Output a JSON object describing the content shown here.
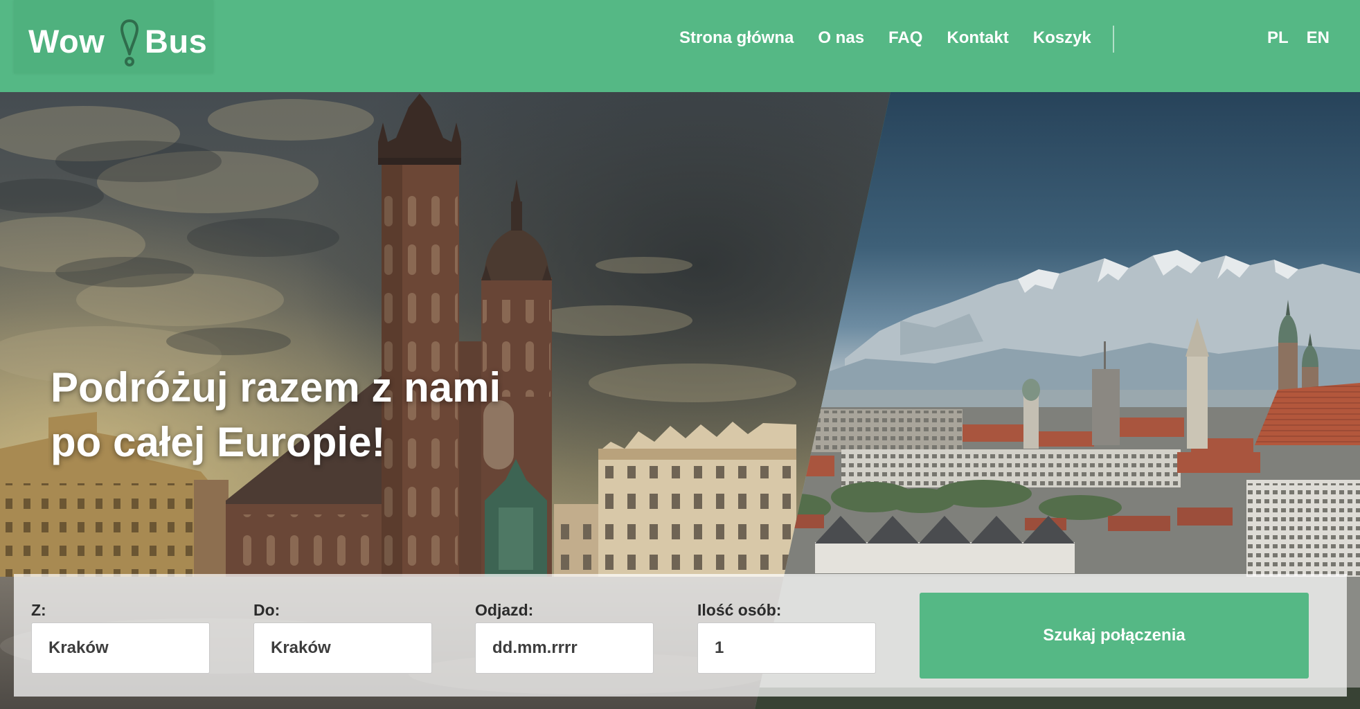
{
  "header": {
    "logo": {
      "part1": "Wow",
      "part2": "Bus",
      "icon": "exclamation-pin-icon"
    },
    "nav": [
      {
        "label": "Strona główna"
      },
      {
        "label": "O nas"
      },
      {
        "label": "FAQ"
      },
      {
        "label": "Kontakt"
      },
      {
        "label": "Koszyk"
      }
    ],
    "languages": [
      {
        "label": "PL"
      },
      {
        "label": "EN"
      }
    ]
  },
  "hero": {
    "title_line1": "Podróżuj razem z nami",
    "title_line2": "po całej Europie!"
  },
  "search": {
    "from": {
      "label": "Z:",
      "value": "Kraków"
    },
    "to": {
      "label": "Do:",
      "value": "Kraków"
    },
    "departure": {
      "label": "Odjazd:",
      "placeholder": "dd.mm.rrrr"
    },
    "passengers": {
      "label": "Ilość osób:",
      "value": "1"
    },
    "submit_label": "Szukaj połączenia"
  },
  "colors": {
    "brand_green": "#55b885",
    "logo_dark_green": "#2f6d4c",
    "text_dark": "#2b2b2b"
  }
}
